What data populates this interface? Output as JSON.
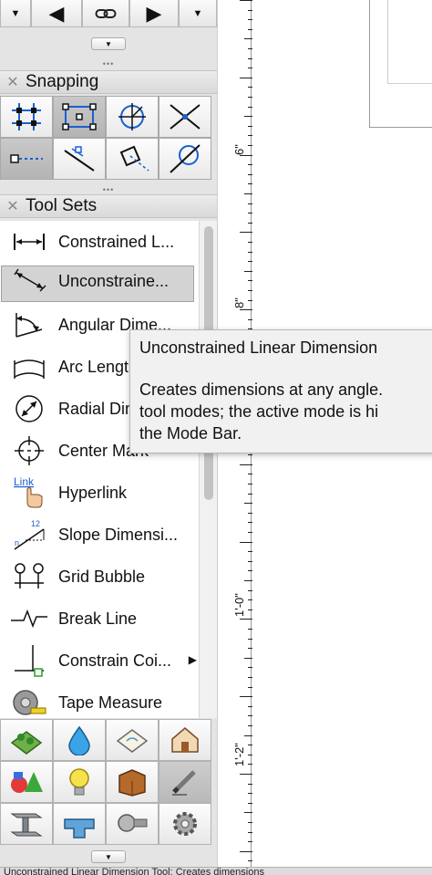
{
  "nav": {
    "prev_label": "◀",
    "next_label": "▶",
    "link_label": "⚭"
  },
  "snapping": {
    "title": "Snapping",
    "buttons": [
      {
        "icon": "snap-to-grid-icon",
        "active": false
      },
      {
        "icon": "snap-to-object-icon",
        "active": true
      },
      {
        "icon": "snap-to-angle-icon",
        "active": false
      },
      {
        "icon": "snap-to-intersection-icon",
        "active": false
      },
      {
        "icon": "smart-points-icon",
        "active": true
      },
      {
        "icon": "snap-to-distance-icon",
        "active": false
      },
      {
        "icon": "smart-edge-icon",
        "active": false
      },
      {
        "icon": "snap-to-tangent-icon",
        "active": false
      }
    ]
  },
  "toolsets": {
    "title": "Tool Sets",
    "items": [
      {
        "label": "Constrained L...",
        "icon": "constrained-linear-dimension-icon"
      },
      {
        "label": "Unconstraine...",
        "icon": "unconstrained-linear-dimension-icon",
        "selected": true
      },
      {
        "label": "Angular Dime...",
        "icon": "angular-dimension-icon"
      },
      {
        "label": "Arc Length",
        "icon": "arc-length-icon"
      },
      {
        "label": "Radial Dim",
        "icon": "radial-dimension-icon"
      },
      {
        "label": "Center Mark",
        "icon": "center-mark-icon"
      },
      {
        "label": "Hyperlink",
        "icon": "hyperlink-icon"
      },
      {
        "label": "Slope Dimensi...",
        "icon": "slope-dimension-icon"
      },
      {
        "label": "Grid Bubble",
        "icon": "grid-bubble-icon"
      },
      {
        "label": "Break Line",
        "icon": "break-line-icon"
      },
      {
        "label": "Constrain Coi...",
        "icon": "constrain-coincident-icon",
        "submenu": true
      },
      {
        "label": "Tape Measure",
        "icon": "tape-measure-icon"
      }
    ]
  },
  "toolset_icons": [
    {
      "icon": "site-planning-icon",
      "active": false
    },
    {
      "icon": "water-drop-icon",
      "active": false
    },
    {
      "icon": "detailing-icon",
      "active": false
    },
    {
      "icon": "building-shell-icon",
      "active": false
    },
    {
      "icon": "visualization-icon",
      "active": false
    },
    {
      "icon": "lighting-icon",
      "active": false
    },
    {
      "icon": "furniture-icon",
      "active": false
    },
    {
      "icon": "dims-notes-icon",
      "active": true
    },
    {
      "icon": "steel-beam-icon",
      "active": false
    },
    {
      "icon": "pipe-fitting-icon",
      "active": false
    },
    {
      "icon": "fasteners-icon",
      "active": false
    },
    {
      "icon": "machine-components-icon",
      "active": false
    }
  ],
  "ruler": {
    "labels": [
      "6\"",
      "8\"",
      "1'-0\"",
      "1'-2\""
    ]
  },
  "tooltip": {
    "title": "Unconstrained Linear Dimension",
    "line1": "Creates dimensions at any angle.",
    "line2": "tool modes; the active mode is hi",
    "line3": "the Mode Bar."
  },
  "status": {
    "text": "Unconstrained Linear Dimension Tool: Creates dimensions"
  }
}
